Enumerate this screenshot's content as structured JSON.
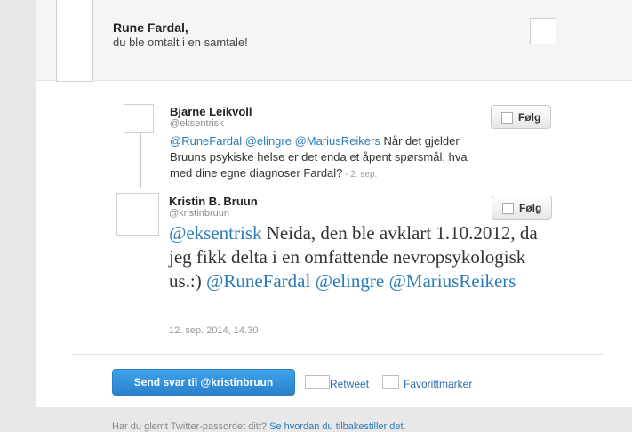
{
  "header": {
    "name": "Rune Fardal,",
    "subtitle": "du ble omtalt i en samtale!"
  },
  "tweets": [
    {
      "name": "Bjarne Leikvoll",
      "handle": "@eksentrisk",
      "follow_label": "Følg",
      "mentions": "@RuneFardal @elingre @MariusReikers",
      "text": " Når det gjelder Bruuns psykiske helse er det enda et åpent spørsmål, hva med dine egne diagnoser Fardal?",
      "timestamp": " - 2. sep."
    },
    {
      "name": "Kristin B. Bruun",
      "handle": "@kristinbruun",
      "follow_label": "Følg",
      "mention_lead": "@eksentrisk",
      "text": " Neida, den ble avklart 1.10.2012, da jeg fikk delta i en omfattende nevropsykologisk us.:) ",
      "mention_tail": "@RuneFardal @elingre @MariusReikers",
      "timestamp": "12. sep. 2014, 14.30"
    }
  ],
  "actions": {
    "reply_label": "Send svar til @kristinbruun",
    "retweet_label": "Retweet",
    "favorite_label": "Favorittmarker"
  },
  "footer": {
    "text": "Har du glemt Twitter-passordet ditt?",
    "link": "Se hvordan du tilbakestiller det."
  },
  "colors": {
    "accent": "#2b7bb9",
    "button": "#2a83cc"
  }
}
